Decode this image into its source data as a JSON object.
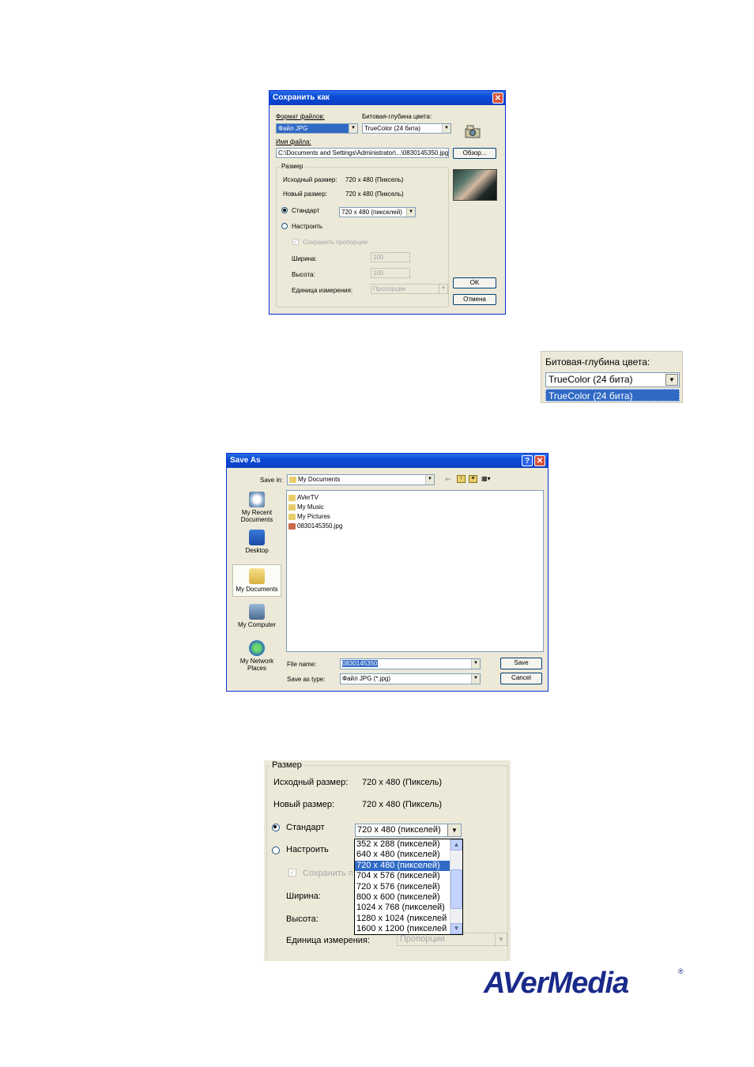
{
  "dialog1": {
    "title": "Сохранить как",
    "format_label": "Формат файлов:",
    "format_value": "Файл JPG",
    "depth_label": "Битовая-глубина цвета:",
    "depth_value": "TrueColor (24 бита)",
    "filename_label": "Имя файла:",
    "filename_value": "C:\\Documents and Settings\\Administrator\\...\\0830145350.jpg",
    "browse_button": "Обзор...",
    "size_group": "Размер",
    "orig_size_label": "Исходный размер:",
    "orig_size_value": "720 x 480 (Пиксель)",
    "new_size_label": "Новый размер:",
    "new_size_value": "720 x 480 (Пиксель)",
    "standard_label": "Стандарт",
    "standard_value": "720 x 480 (пикселей)",
    "custom_label": "Настроить",
    "keep_ratio_label": "Сохранить пропорции",
    "width_label": "Ширина:",
    "width_value": "100",
    "height_label": "Высота:",
    "height_value": "100",
    "unit_label": "Единица измерения:",
    "unit_value": "Пропорции",
    "ok_button": "OK",
    "cancel_button": "Отмена"
  },
  "depth_dropdown": {
    "label": "Битовая-глубина цвета:",
    "value": "TrueColor (24 бита)",
    "options": [
      "TrueColor (24 бита)"
    ]
  },
  "dialog2": {
    "title": "Save As",
    "save_in_label": "Save in:",
    "save_in_value": "My Documents",
    "places": [
      "My Recent Documents",
      "Desktop",
      "My Documents",
      "My Computer",
      "My Network Places"
    ],
    "files": [
      "AVerTV",
      "My Music",
      "My Pictures",
      "0830145350.jpg"
    ],
    "file_name_label": "File name:",
    "file_name_value": "0830145350",
    "save_type_label": "Save as type:",
    "save_type_value": "Файл JPG (*.jpg)",
    "save_button": "Save",
    "cancel_button": "Cancel"
  },
  "size_zoom": {
    "group": "Размер",
    "orig_size_label": "Исходный размер:",
    "orig_size_value": "720 x 480 (Пиксель)",
    "new_size_label": "Новый размер:",
    "new_size_value": "720 x 480 (Пиксель)",
    "standard_label": "Стандарт",
    "standard_value": "720 x 480 (пикселей)",
    "custom_label": "Настроить",
    "keep_ratio_label": "Сохранить п",
    "width_label": "Ширина:",
    "height_label": "Высота:",
    "unit_label": "Единица измерения:",
    "unit_value": "Пропорции",
    "options": [
      "352 x 288 (пикселей)",
      "640 x 480 (пикселей)",
      "720 x 480 (пикселей)",
      "704 x 576 (пикселей)",
      "720 x 576 (пикселей)",
      "800 x 600 (пикселей)",
      "1024 x 768 (пикселей)",
      "1280 x 1024 (пикселей",
      "1600 x 1200 (пикселей"
    ],
    "selected_option": "720 x 480 (пикселей)"
  },
  "logo": {
    "text": "AVerMedia",
    "color": "#1a2a8a"
  }
}
